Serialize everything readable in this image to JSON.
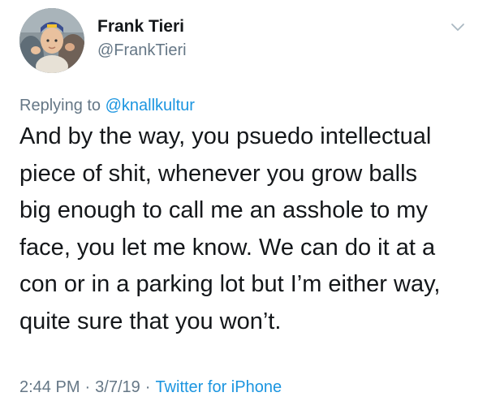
{
  "author": {
    "display_name": "Frank Tieri",
    "handle": "@FrankTieri",
    "avatar_icon": "profile-photo-avatar"
  },
  "menu": {
    "icon": "chevron-down-icon"
  },
  "reply": {
    "prefix": "Replying to ",
    "mention": "@knallkultur"
  },
  "tweet": {
    "lines": [
      "And by the way, you psuedo intellectual",
      "piece of shit, whenever you grow balls",
      "big enough to call me an asshole to my",
      "face, you let me know. We can do it at a",
      "con or in a parking lot but I’m either way,",
      "quite sure that you won’t."
    ]
  },
  "meta": {
    "time": "2:44 PM",
    "separator": "·",
    "date": "3/7/19",
    "source": "Twitter for iPhone"
  },
  "colors": {
    "text": "#14171a",
    "secondary": "#657786",
    "link": "#1b95e0",
    "background": "#ffffff"
  }
}
